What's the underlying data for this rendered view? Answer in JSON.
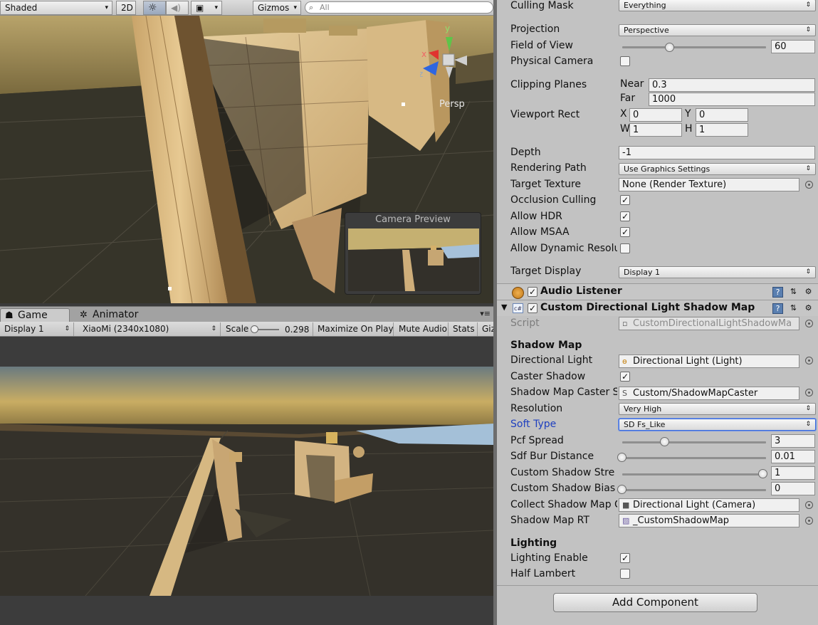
{
  "scene_toolbar": {
    "draw_mode": "Shaded",
    "mode_2d": "2D",
    "lighting_icon": "sun-icon",
    "audio_icon": "speaker-icon",
    "effects_icon": "image-icon",
    "gizmos": "Gizmos",
    "search_placeholder": "All"
  },
  "scene_view": {
    "persp_label": "Persp",
    "gizmo_axes": {
      "x": "x",
      "y": "y",
      "z": "z"
    },
    "camera_preview_title": "Camera Preview"
  },
  "game_tabs": {
    "game": "Game",
    "animator": "Animator",
    "menu_icon": "▾≡"
  },
  "game_toolbar": {
    "display": "Display 1",
    "resolution": "XiaoMi (2340x1080)",
    "scale_label": "Scale",
    "scale_value": "0.298",
    "maximize": "Maximize On Play",
    "mute": "Mute Audio",
    "stats": "Stats",
    "gizmos": "Giz"
  },
  "inspector": {
    "camera": {
      "culling_mask": {
        "label": "Culling Mask",
        "value": "Everything"
      },
      "projection": {
        "label": "Projection",
        "value": "Perspective"
      },
      "fov": {
        "label": "Field of View",
        "value": "60",
        "fraction": 0.4
      },
      "physical_camera": {
        "label": "Physical Camera",
        "checked": false
      },
      "clipping_planes": {
        "label": "Clipping Planes",
        "near_label": "Near",
        "near": "0.3",
        "far_label": "Far",
        "far": "1000"
      },
      "viewport_rect": {
        "label": "Viewport Rect",
        "x_label": "X",
        "x": "0",
        "y_label": "Y",
        "y": "0",
        "w_label": "W",
        "w": "1",
        "h_label": "H",
        "h": "1"
      },
      "depth": {
        "label": "Depth",
        "value": "-1"
      },
      "rendering_path": {
        "label": "Rendering Path",
        "value": "Use Graphics Settings"
      },
      "target_texture": {
        "label": "Target Texture",
        "value": "None (Render Texture)"
      },
      "occlusion_culling": {
        "label": "Occlusion Culling",
        "checked": true
      },
      "allow_hdr": {
        "label": "Allow HDR",
        "checked": true
      },
      "allow_msaa": {
        "label": "Allow MSAA",
        "checked": true
      },
      "allow_dynamic": {
        "label": "Allow Dynamic Resolu",
        "checked": false
      },
      "target_display": {
        "label": "Target Display",
        "value": "Display 1"
      }
    },
    "audio_listener": {
      "title": "Audio Listener",
      "enabled": true
    },
    "shadow_component": {
      "title": "Custom Directional Light Shadow Map",
      "enabled": true,
      "script": {
        "label": "Script",
        "value": "CustomDirectionalLightShadowMa"
      },
      "section_shadow_map": "Shadow Map",
      "directional_light": {
        "label": "Directional Light",
        "value": "Directional Light (Light)"
      },
      "caster_shadow": {
        "label": "Caster Shadow",
        "checked": true
      },
      "shadow_map_caster": {
        "label": "Shadow Map Caster S",
        "value": "Custom/ShadowMapCaster"
      },
      "resolution": {
        "label": "Resolution",
        "value": "Very High"
      },
      "soft_type": {
        "label": "Soft Type",
        "value": "SD Fs_Like"
      },
      "pcf_spread": {
        "label": "Pcf Spread",
        "value": "3",
        "fraction": 0.29
      },
      "sdf_bur_distance": {
        "label": "Sdf Bur Distance",
        "value": "0.01",
        "fraction": 0.0
      },
      "custom_shadow_strength": {
        "label": "Custom Shadow Stre",
        "value": "1",
        "fraction": 1.0
      },
      "custom_shadow_bias": {
        "label": "Custom Shadow Bias",
        "value": "0",
        "fraction": 0.0
      },
      "collect_shadow_map": {
        "label": "Collect Shadow Map C",
        "value": "Directional Light (Camera)"
      },
      "shadow_map_rt": {
        "label": "Shadow Map RT",
        "value": "_CustomShadowMap"
      },
      "section_lighting": "Lighting",
      "lighting_enable": {
        "label": "Lighting Enable",
        "checked": true
      },
      "half_lambert": {
        "label": "Half Lambert",
        "checked": false
      }
    },
    "add_component": "Add Component"
  }
}
